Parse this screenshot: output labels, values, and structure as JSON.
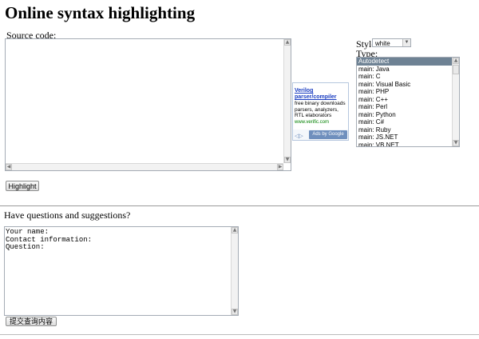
{
  "page": {
    "title": "Online syntax highlighting"
  },
  "source": {
    "label": "Source code:",
    "value": ""
  },
  "highlight": {
    "label": "Highlight"
  },
  "style": {
    "label": "Style:",
    "selected": "white"
  },
  "type": {
    "label": "Type:",
    "options": [
      "Autodetect",
      "main: Java",
      "main: C",
      "main: Visual Basic",
      "main: PHP",
      "main: C++",
      "main: Perl",
      "main: Python",
      "main: C#",
      "main: Ruby",
      "main: JS.NET",
      "main: VB.NET"
    ],
    "selected_index": 0
  },
  "ad": {
    "link_line1": "Verilog",
    "link_line2": "parser/compiler",
    "desc_line1": "free binary downloads",
    "desc_line2": "parsers, analyzers,",
    "desc_line3": "RTL elaborators",
    "url": "www.verific.com",
    "ads_by": "Ads by Google"
  },
  "feedback": {
    "label": "Have questions and suggestions?",
    "value": "Your name:\nContact information:\nQuestion:",
    "submit_label": "提交查询内容"
  }
}
